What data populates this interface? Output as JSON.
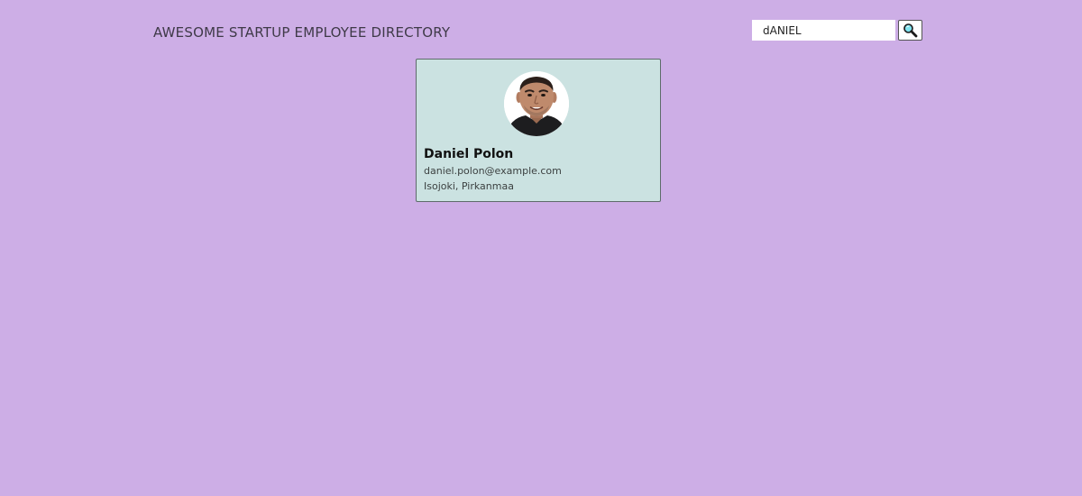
{
  "header": {
    "title": "AWESOME STARTUP EMPLOYEE DIRECTORY"
  },
  "search": {
    "value": "dANIEL",
    "button_icon": "magnifying-glass-icon"
  },
  "colors": {
    "background": "#cdaee6",
    "card_background": "#cbe2e1",
    "card_border": "#5d6b6a"
  },
  "employees": [
    {
      "name": "Daniel Polon",
      "email": "daniel.polon@example.com",
      "location": "Isojoki, Pirkanmaa",
      "avatar_icon": "employee-photo"
    }
  ]
}
